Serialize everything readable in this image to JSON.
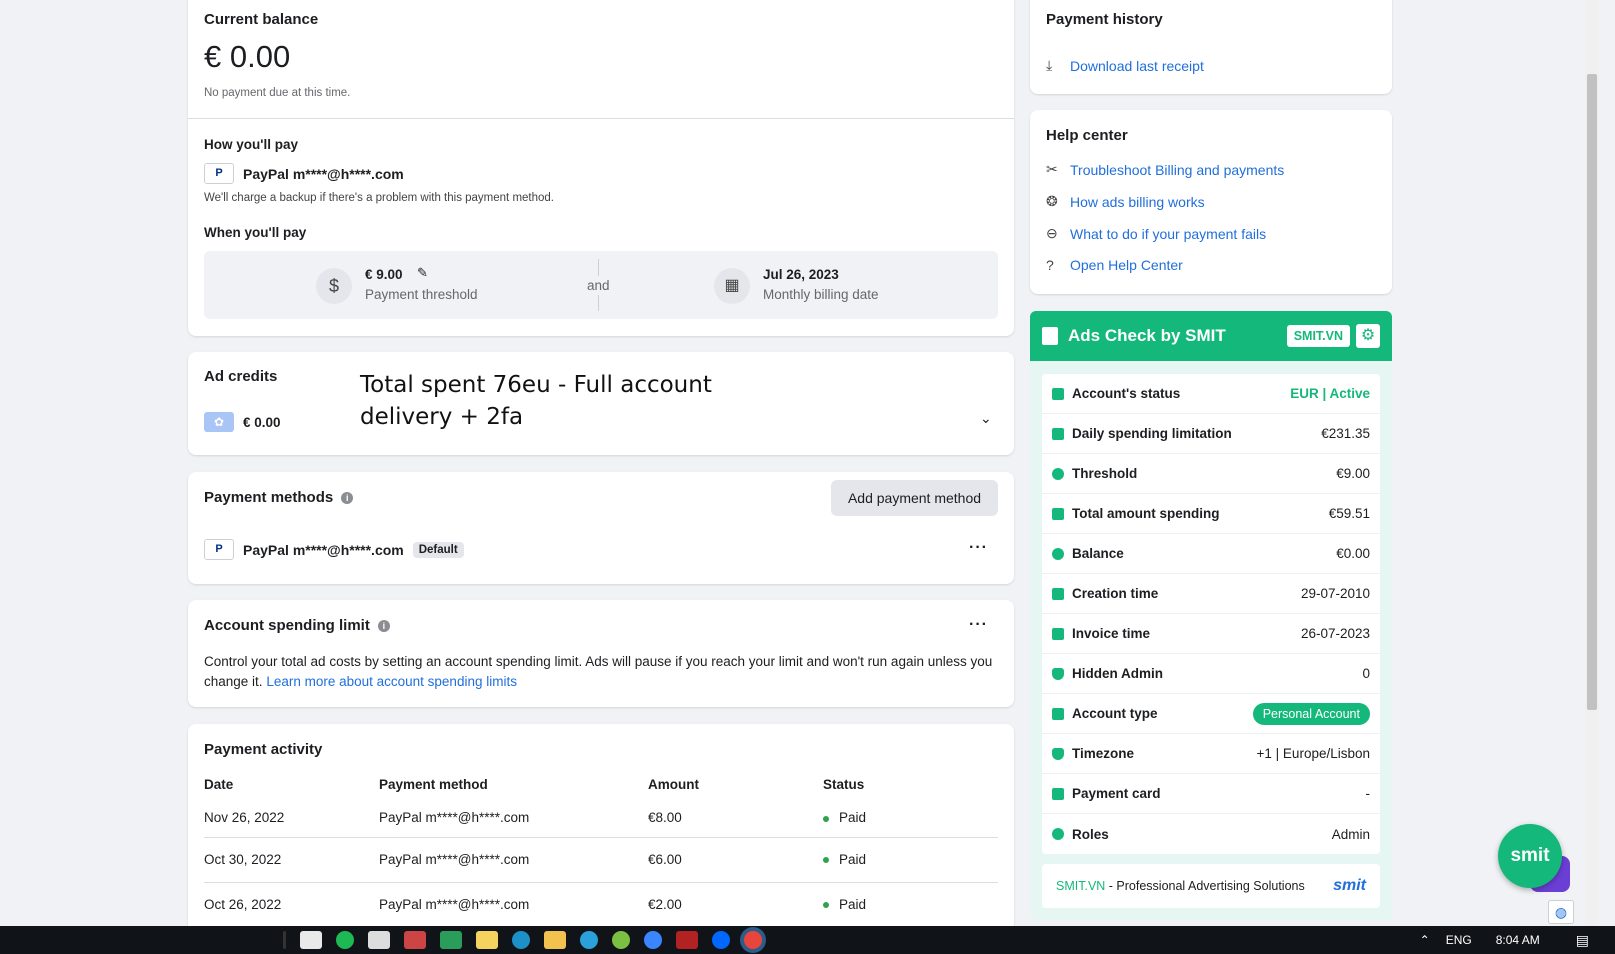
{
  "balance": {
    "title": "Current balance",
    "amount": "€ 0.00",
    "note": "No payment due at this time.",
    "how_title": "How you'll pay",
    "method": "PayPal m****@h****.com",
    "backup_note": "We'll charge a backup if there's a problem with this payment method.",
    "when_title": "When you'll pay",
    "threshold_value": "€ 9.00",
    "threshold_label": "Payment threshold",
    "and": "and",
    "billing_date": "Jul 26, 2023",
    "billing_label": "Monthly billing date"
  },
  "ad_credits": {
    "title": "Ad credits",
    "value": "€ 0.00",
    "overlay_line1": "Total spent 76eu - Full account",
    "overlay_line2": "delivery + 2fa"
  },
  "payment_methods": {
    "title": "Payment methods",
    "add_button": "Add payment method",
    "method": "PayPal m****@h****.com",
    "default_badge": "Default"
  },
  "spending_limit": {
    "title": "Account spending limit",
    "text": "Control your total ad costs by setting an account spending limit. Ads will pause if you reach your limit and won't run again unless you change it.",
    "link": "Learn more about account spending limits"
  },
  "activity": {
    "title": "Payment activity",
    "columns": [
      "Date",
      "Payment method",
      "Amount",
      "Status"
    ],
    "rows": [
      {
        "date": "Nov 26, 2022",
        "method": "PayPal m****@h****.com",
        "amount": "€8.00",
        "status": "Paid"
      },
      {
        "date": "Oct 30, 2022",
        "method": "PayPal m****@h****.com",
        "amount": "€6.00",
        "status": "Paid"
      },
      {
        "date": "Oct 26, 2022",
        "method": "PayPal m****@h****.com",
        "amount": "€2.00",
        "status": "Paid"
      }
    ]
  },
  "history": {
    "title": "Payment history",
    "download": "Download last receipt"
  },
  "help": {
    "title": "Help center",
    "links": [
      "Troubleshoot Billing and payments",
      "How ads billing works",
      "What to do if your payment fails",
      "Open Help Center"
    ]
  },
  "smit": {
    "title": "Ads Check by SMIT",
    "badge": "SMIT.VN",
    "rows": [
      {
        "label": "Account's status",
        "value": "EUR | Active"
      },
      {
        "label": "Daily spending limitation",
        "value": "€231.35"
      },
      {
        "label": "Threshold",
        "value": "€9.00"
      },
      {
        "label": "Total amount spending",
        "value": "€59.51"
      },
      {
        "label": "Balance",
        "value": "€0.00"
      },
      {
        "label": "Creation time",
        "value": "29-07-2010"
      },
      {
        "label": "Invoice time",
        "value": "26-07-2023"
      },
      {
        "label": "Hidden Admin",
        "value": "0"
      },
      {
        "label": "Account type",
        "value": "Personal Account"
      },
      {
        "label": "Timezone",
        "value": "+1 | Europe/Lisbon"
      },
      {
        "label": "Payment card",
        "value": "-"
      },
      {
        "label": "Roles",
        "value": "Admin"
      }
    ],
    "footer_brand": "SMIT.VN",
    "footer_text": " - Professional Advertising Solutions",
    "footer_logo": "smit",
    "bubble": "smit"
  },
  "taskbar": {
    "lang": "ENG",
    "time": "8:04 AM"
  },
  "colors": {
    "link": "#216fdb",
    "smit_green": "#14b87a",
    "status_active": "#14b87a",
    "paid_dot": "#31a24c"
  },
  "icons": [
    "paypal-icon",
    "pencil-icon",
    "dollar-circle-icon",
    "calendar-icon",
    "chevron-down-icon",
    "info-icon",
    "more-icon",
    "download-icon",
    "wrench-icon",
    "network-icon",
    "minus-circle-icon",
    "question-circle-icon",
    "gear-icon",
    "globe-icon",
    "chat-icon"
  ]
}
